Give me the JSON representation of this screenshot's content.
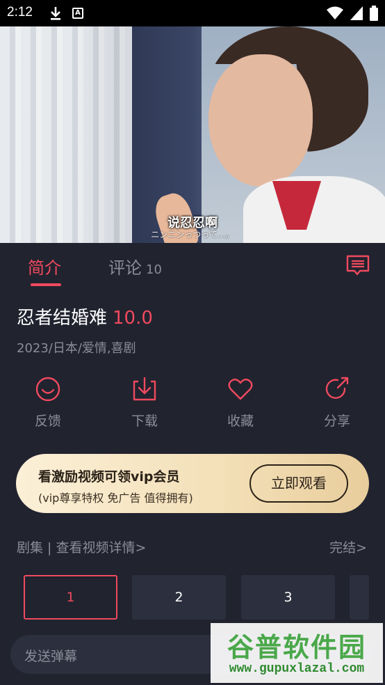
{
  "status_bar": {
    "time": "2:12"
  },
  "video": {
    "subtitle_cn": "说忍忍啊",
    "subtitle_jp": "ニンニンっつって…。"
  },
  "tabs": [
    {
      "label": "简介"
    },
    {
      "label": "评论",
      "count": "10"
    }
  ],
  "show": {
    "title": "忍者结婚难",
    "score": "10.0",
    "meta": "2023/日本/爱情,喜剧"
  },
  "actions": [
    {
      "label": "反馈",
      "icon": "smile-icon"
    },
    {
      "label": "下载",
      "icon": "download-icon"
    },
    {
      "label": "收藏",
      "icon": "heart-icon"
    },
    {
      "label": "分享",
      "icon": "share-icon"
    }
  ],
  "vip": {
    "title": "看激励视频可领vip会员",
    "subtitle": "(vip尊享特权 免广告 值得拥有)",
    "button": "立即观看"
  },
  "episodes": {
    "header": "剧集 | 查看视频详情>",
    "status": "完结>",
    "items": [
      "1",
      "2",
      "3"
    ],
    "selected": "1"
  },
  "danmu": {
    "placeholder": "发送弹幕"
  },
  "watermark": {
    "name": "谷普软件园",
    "url": "www.gupuxlazal.com"
  },
  "colors": {
    "accent": "#f04a5e",
    "background": "#21232f",
    "muted": "#8a8d98"
  }
}
